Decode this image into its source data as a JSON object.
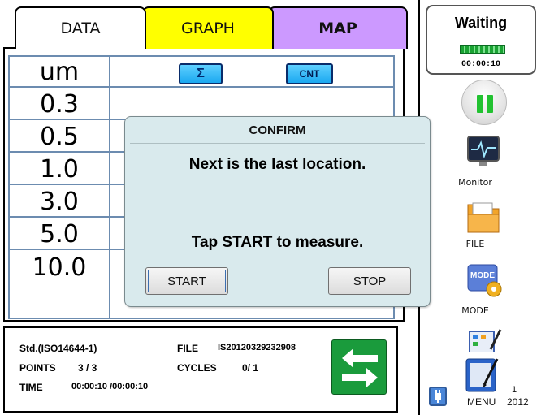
{
  "tabs": {
    "data": "DATA",
    "graph": "GRAPH",
    "map": "MAP"
  },
  "grid": {
    "header": "um",
    "sizes": [
      "0.3",
      "0.5",
      "1.0",
      "3.0",
      "5.0",
      "10.0"
    ],
    "sum_button": "Σ",
    "count_button": "CNT"
  },
  "info": {
    "standard": "Std.(ISO14644-1)",
    "file_label": "FILE",
    "file_value": "IS20120329232908",
    "points_label": "POINTS",
    "points_value": "3 / 3",
    "cycles_label": "CYCLES",
    "cycles_value": "0/ 1",
    "time_label": "TIME",
    "time_value": "00:00:10 /00:00:10"
  },
  "status": {
    "title": "Waiting",
    "time": "00:00:10",
    "progress": 1.0
  },
  "side": {
    "monitor": "Monitor",
    "file": "FILE",
    "mode": "MODE",
    "menu": "MENU",
    "year": "2012",
    "frag": "1"
  },
  "dialog": {
    "title": "CONFIRM",
    "message1": "Next is the last location.",
    "message2": "Tap START to measure.",
    "start": "START",
    "stop": "STOP"
  },
  "colors": {
    "graph_tab": "#ffff00",
    "map_tab": "#cc99ff",
    "accent_blue": "#1aa8f0",
    "pause_green": "#22c231",
    "swap_green": "#1a9b3c"
  }
}
